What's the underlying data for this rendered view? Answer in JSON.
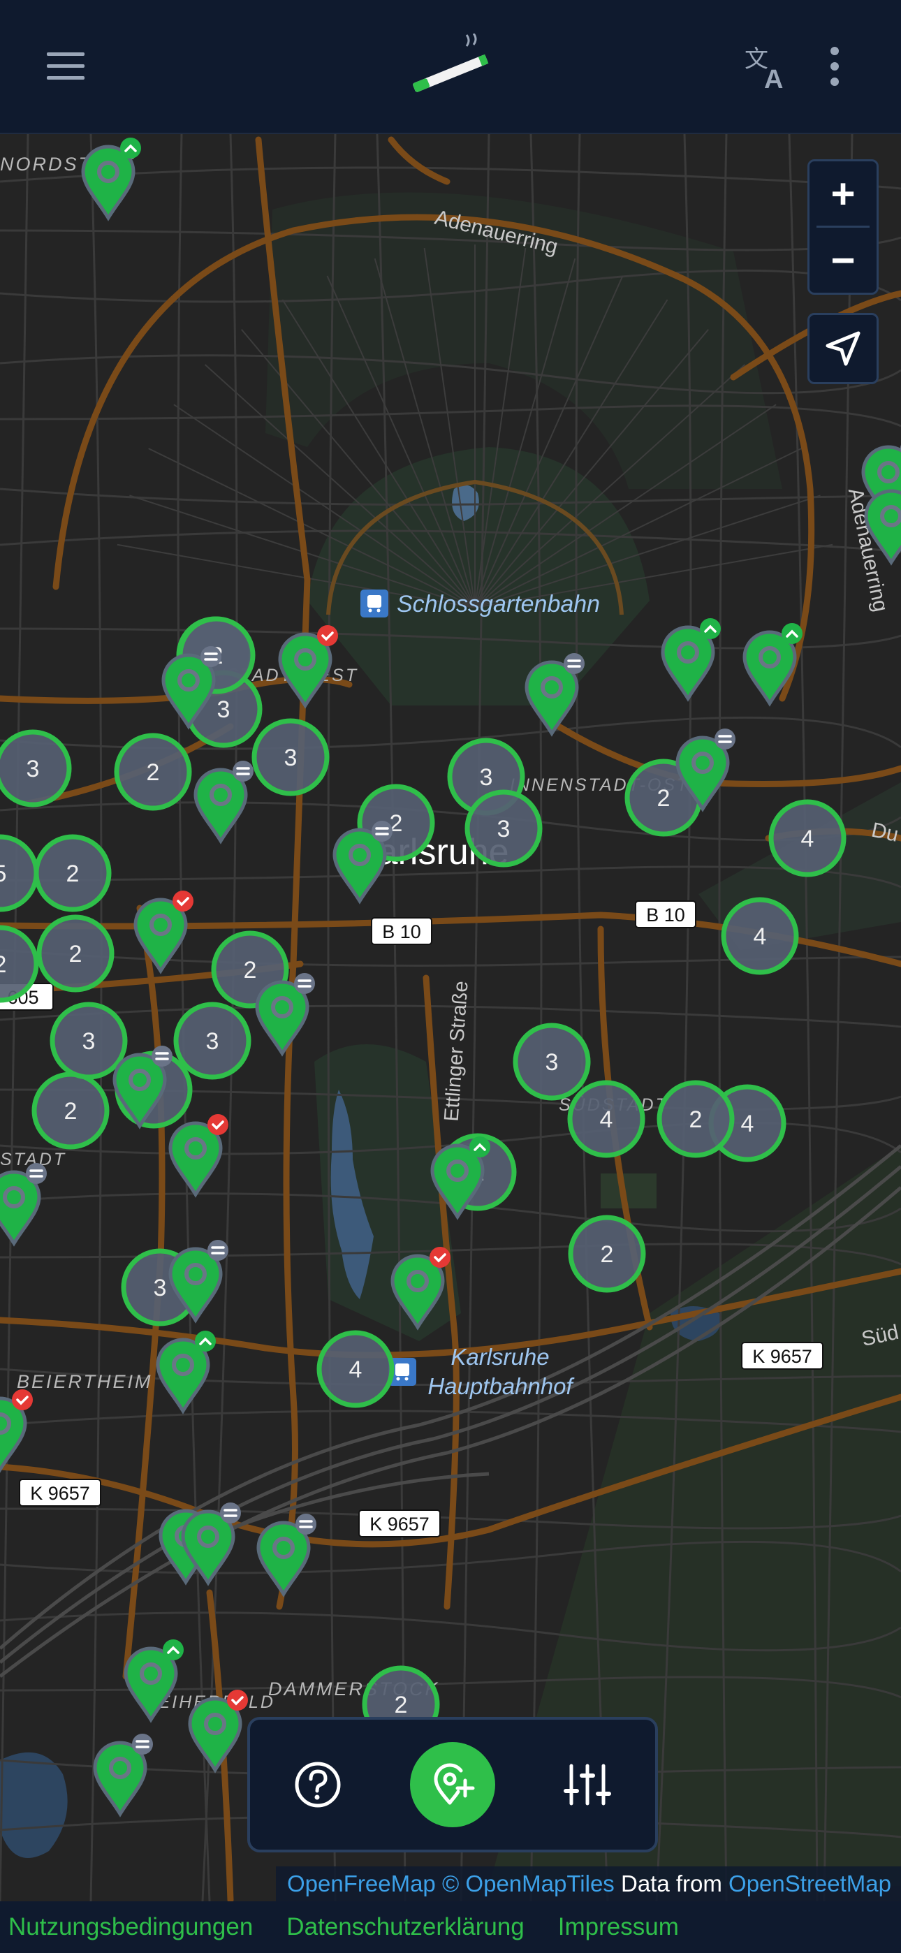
{
  "topbar": {
    "menu_icon": "menu-icon",
    "logo_icon": "cigarette-logo-icon",
    "translate_icon": "translate-icon",
    "more_icon": "more-vertical-icon"
  },
  "map": {
    "place_labels": [
      {
        "id": "nordstadt",
        "text": "NORDSTADT"
      },
      {
        "id": "innenstadt-west",
        "text": "INNENSTADT-WEST"
      },
      {
        "id": "innenstadt-ost",
        "text": "INNENSTADT-OST"
      },
      {
        "id": "karlsruhe",
        "text": "Karlsruhe"
      },
      {
        "id": "suedstadt",
        "text": "SÜDSTADT"
      },
      {
        "id": "beiertheim",
        "text": "BEIERTHEIM"
      },
      {
        "id": "weiherfeld",
        "text": "WEIHERFELD"
      },
      {
        "id": "dammerstock",
        "text": "DAMMERSTOCK"
      },
      {
        "id": "stadt-left",
        "text": "STADT"
      }
    ],
    "street_labels": [
      {
        "id": "adenauerring-top",
        "text": "Adenauerring"
      },
      {
        "id": "adenauerring-right",
        "text": "Adenauerring"
      },
      {
        "id": "ettlinger",
        "text": "Ettlinger Straße"
      },
      {
        "id": "durlacher",
        "text": "Du"
      },
      {
        "id": "suedtangente",
        "text": "Süd"
      }
    ],
    "road_shields": [
      {
        "id": "b10-a",
        "text": "B 10"
      },
      {
        "id": "b10-b",
        "text": "B 10"
      },
      {
        "id": "605",
        "text": "605"
      },
      {
        "id": "k9657-a",
        "text": "K 9657"
      },
      {
        "id": "k9657-b",
        "text": "K 9657"
      },
      {
        "id": "k9657-c",
        "text": "K 9657"
      }
    ],
    "poi_labels": [
      {
        "id": "schlossgartenbahn",
        "text": "Schlossgartenbahn"
      },
      {
        "id": "hbf-1",
        "text": "Karlsruhe"
      },
      {
        "id": "hbf-2",
        "text": "Hauptbahnhof"
      }
    ],
    "clusters": [
      "2",
      "3",
      "3",
      "2",
      "3",
      "3",
      "2",
      "4",
      "3",
      "2",
      "2",
      "4",
      "2",
      "5",
      "2",
      "2",
      "3",
      "3",
      "3",
      "2",
      "4",
      "2",
      "4",
      "3",
      "2",
      "2",
      "3",
      "4",
      "2",
      "2"
    ],
    "marker_badges": {
      "up": "up-chevron-badge",
      "equal": "equal-badge",
      "check": "check-badge"
    }
  },
  "controls": {
    "zoom_in": "+",
    "zoom_out": "−",
    "locate_icon": "navigation-arrow-icon"
  },
  "actionbar": {
    "help_icon": "help-icon",
    "add_location_icon": "add-location-icon",
    "filter_icon": "filter-sliders-icon"
  },
  "attribution": {
    "openfreemap": "OpenFreeMap",
    "openmaptiles": "© OpenMapTiles",
    "data_from": "Data from",
    "openstreetmap": "OpenStreetMap"
  },
  "footer": {
    "terms": "Nutzungsbedingungen",
    "privacy": "Datenschutzerklärung",
    "imprint": "Impressum"
  },
  "colors": {
    "topbar_bg": "#0f1a2e",
    "accent_green": "#2fbf4a",
    "cluster_fill": "#566072",
    "badge_red": "#e53935",
    "link_blue": "#3ca0e8"
  }
}
